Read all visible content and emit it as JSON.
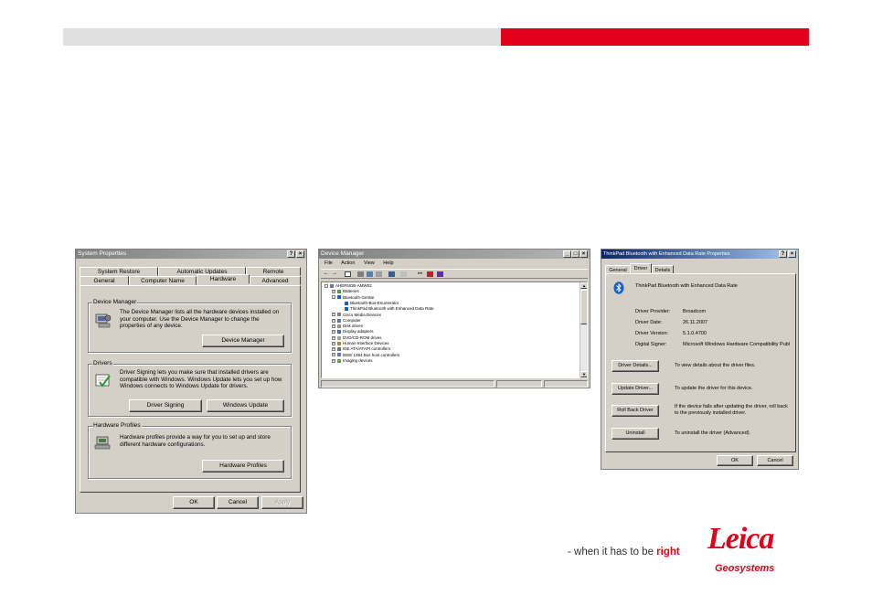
{
  "system_properties": {
    "title": "System Properties",
    "help_btn": "?",
    "close_btn": "×",
    "tabs_back": [
      "System Restore",
      "Automatic Updates",
      "Remote"
    ],
    "tabs_front": [
      "General",
      "Computer Name",
      "Hardware",
      "Advanced"
    ],
    "device_manager": {
      "label": "Device Manager",
      "text": "The Device Manager lists all the hardware devices installed on your computer. Use the Device Manager to change the properties of any device.",
      "button": "Device Manager"
    },
    "drivers": {
      "label": "Drivers",
      "text": "Driver Signing lets you make sure that installed drivers are compatible with Windows. Windows Update lets you set up how Windows connects to Windows Update for drivers.",
      "button1": "Driver Signing",
      "button2": "Windows Update"
    },
    "hardware_profiles": {
      "label": "Hardware Profiles",
      "text": "Hardware profiles provide a way for you to set up and store different hardware configurations.",
      "button": "Hardware Profiles"
    },
    "ok": "OK",
    "cancel": "Cancel",
    "apply": "Apply"
  },
  "device_manager": {
    "title": "Device Manager",
    "menu": [
      "File",
      "Action",
      "View",
      "Help"
    ],
    "tree": [
      {
        "text": "AHERNOB-AMW02",
        "level": 0,
        "exp": "-"
      },
      {
        "text": "Batteries",
        "level": 1,
        "exp": "+"
      },
      {
        "text": "Bluetooth-Geräte",
        "level": 1,
        "exp": "-"
      },
      {
        "text": "Bluetooth-Bus-Enumerator",
        "level": 2,
        "exp": ""
      },
      {
        "text": "ThinkPad Bluetooth with Enhanced Data Rate",
        "level": 2,
        "exp": ""
      },
      {
        "text": "Cisco Media Devices",
        "level": 1,
        "exp": "+"
      },
      {
        "text": "Computer",
        "level": 1,
        "exp": "+"
      },
      {
        "text": "Disk drives",
        "level": 1,
        "exp": "+"
      },
      {
        "text": "Display adapters",
        "level": 1,
        "exp": "+"
      },
      {
        "text": "DVD/CD-ROM drives",
        "level": 1,
        "exp": "+"
      },
      {
        "text": "Human Interface Devices",
        "level": 1,
        "exp": "+"
      },
      {
        "text": "IDE ATA/ATAPI controllers",
        "level": 1,
        "exp": "+"
      },
      {
        "text": "IEEE 1394 Bus host controllers",
        "level": 1,
        "exp": "+"
      },
      {
        "text": "Imaging devices",
        "level": 1,
        "exp": "+"
      }
    ]
  },
  "bt_props": {
    "title": "ThinkPad Bluetooth with Enhanced Data Rate Properties",
    "help_btn": "?",
    "close_btn": "×",
    "tabs": [
      "General",
      "Driver",
      "Details"
    ],
    "device_name": "ThinkPad Bluetooth with Enhanced Data Rate",
    "fields": [
      {
        "label": "Driver Provider:",
        "value": "Broadcom"
      },
      {
        "label": "Driver Date:",
        "value": "26.11.2007"
      },
      {
        "label": "Driver Version:",
        "value": "5.1.0.4700"
      },
      {
        "label": "Digital Signer:",
        "value": "Microsoft Windows Hardware Compatibility Publ"
      }
    ],
    "actions": [
      {
        "button": "Driver Details...",
        "desc": "To view details about the driver files."
      },
      {
        "button": "Update Driver...",
        "desc": "To update the driver for this device."
      },
      {
        "button": "Roll Back Driver",
        "desc": "If the device fails after updating the driver, roll back to the previously installed driver."
      },
      {
        "button": "Uninstall",
        "desc": "To uninstall the driver (Advanced)."
      }
    ],
    "ok": "OK",
    "cancel": "Cancel"
  },
  "footer": {
    "tagline_prefix": "- when it has to be ",
    "tagline_emph": "right",
    "logo_text": "Leica",
    "logo_sub": "Geosystems",
    "brand_red": "#e2001a"
  }
}
